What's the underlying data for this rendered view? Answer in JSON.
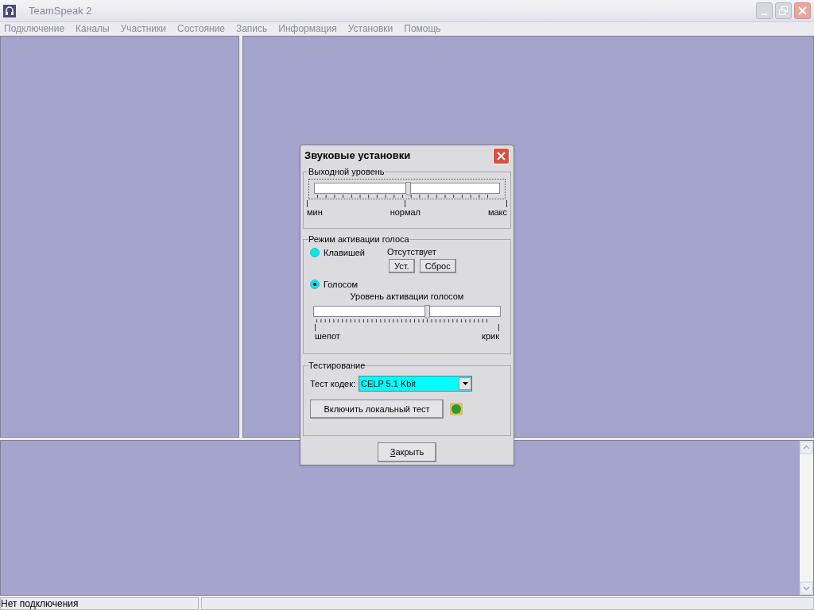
{
  "window": {
    "title": "TeamSpeak 2"
  },
  "menu": [
    "Подключение",
    "Каналы",
    "Участники",
    "Состояние",
    "Запись",
    "Информация",
    "Установки",
    "Помощь"
  ],
  "dialog": {
    "title": "Звуковые установки",
    "output": {
      "label": "Выходной уровень",
      "level": 0.51,
      "ticks": [
        "мин",
        "нормал",
        "макс"
      ]
    },
    "activation": {
      "label": "Режим активации голоса",
      "radios": [
        {
          "label": "Клавишей",
          "selected": false
        },
        {
          "label": "Голосом",
          "selected": true
        }
      ],
      "hotkey_status": "Отсутствует",
      "buttons": [
        "Уст.",
        "Сброс"
      ],
      "voice_label": "Уровень активации голосом",
      "level": 0.61,
      "ticks": [
        "шепот",
        "крик"
      ]
    },
    "testing": {
      "label": "Тестирование",
      "codec_label": "Тест кодек:",
      "codec_value": "CELP 5.1 Kbit",
      "test_button": "Включить локальный тест"
    },
    "close_button": "Закрыть"
  },
  "status_bar": {
    "text": "Нет подключения"
  }
}
